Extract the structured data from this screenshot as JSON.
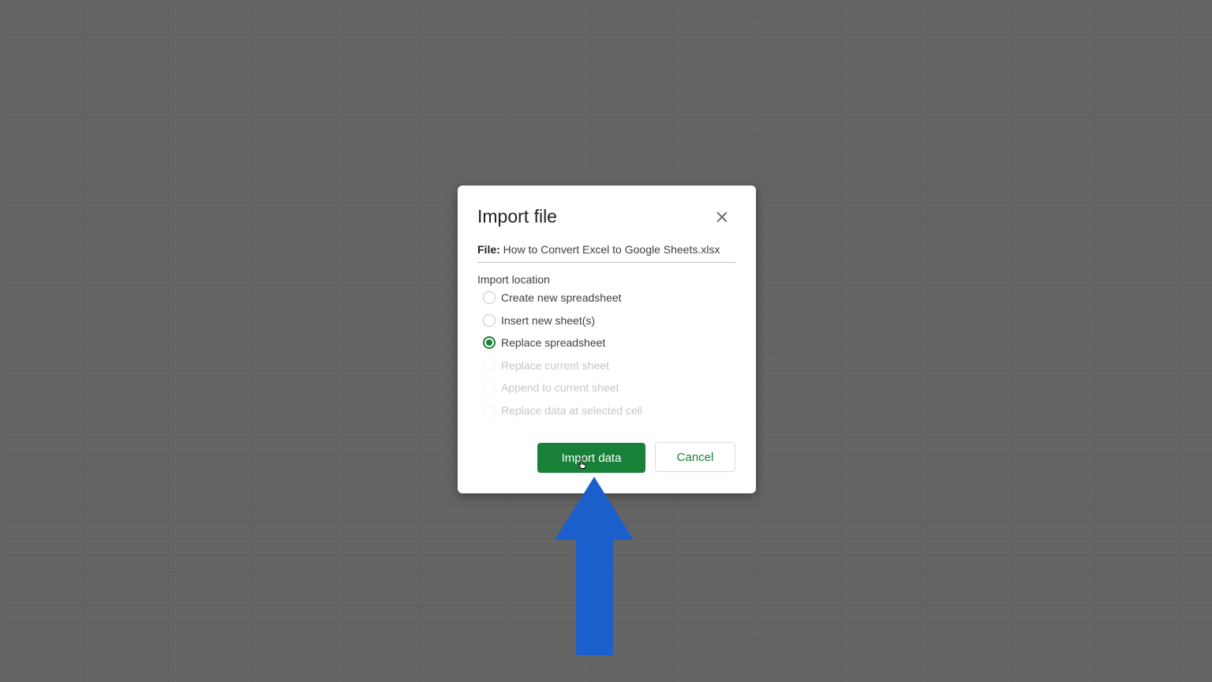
{
  "dialog": {
    "title": "Import file",
    "file_label": "File:",
    "file_name": "How to Convert Excel to Google Sheets.xlsx",
    "section_label": "Import location",
    "options": [
      {
        "label": "Create new spreadsheet",
        "selected": false,
        "disabled": false
      },
      {
        "label": "Insert new sheet(s)",
        "selected": false,
        "disabled": false
      },
      {
        "label": "Replace spreadsheet",
        "selected": true,
        "disabled": false
      },
      {
        "label": "Replace current sheet",
        "selected": false,
        "disabled": true
      },
      {
        "label": "Append to current sheet",
        "selected": false,
        "disabled": true
      },
      {
        "label": "Replace data at selected cell",
        "selected": false,
        "disabled": true
      }
    ],
    "primary_button": "Import data",
    "secondary_button": "Cancel",
    "close_icon": "close-icon"
  },
  "colors": {
    "accent": "#188038",
    "annotation_arrow": "#1a5fcc",
    "backdrop": "#666666"
  },
  "annotation": {
    "icon": "up-arrow-icon"
  }
}
